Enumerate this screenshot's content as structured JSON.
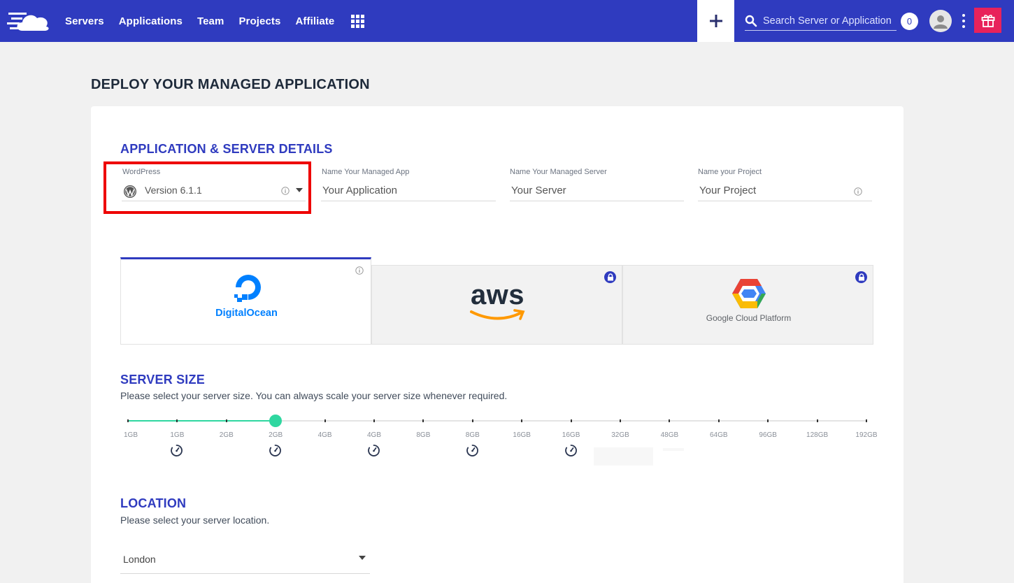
{
  "nav": {
    "items": [
      "Servers",
      "Applications",
      "Team",
      "Projects",
      "Affiliate"
    ]
  },
  "search": {
    "placeholder": "Search Server or Application"
  },
  "notifications": {
    "count": "0"
  },
  "page": {
    "title": "DEPLOY YOUR MANAGED APPLICATION"
  },
  "app_details": {
    "title": "APPLICATION & SERVER DETAILS",
    "fields": [
      {
        "label": "WordPress",
        "value": "Version 6.1.1"
      },
      {
        "label": "Name Your Managed App",
        "value": "Your Application"
      },
      {
        "label": "Name Your Managed Server",
        "value": "Your Server"
      },
      {
        "label": "Name your Project",
        "value": "Your Project"
      }
    ]
  },
  "providers": [
    {
      "name": "DigitalOcean",
      "locked": false,
      "selected": true
    },
    {
      "name": "aws",
      "locked": true,
      "selected": false
    },
    {
      "name": "Google Cloud Platform",
      "locked": true,
      "selected": false
    }
  ],
  "server_size": {
    "title": "SERVER SIZE",
    "subtitle": "Please select your server size. You can always scale your server size whenever required.",
    "ticks": [
      "1GB",
      "1GB",
      "2GB",
      "2GB",
      "4GB",
      "4GB",
      "8GB",
      "8GB",
      "16GB",
      "16GB",
      "32GB",
      "48GB",
      "64GB",
      "96GB",
      "128GB",
      "192GB"
    ],
    "selected_index": 3
  },
  "location": {
    "title": "LOCATION",
    "subtitle": "Please select your server location.",
    "value": "London"
  },
  "colors": {
    "primary": "#2f3bbf",
    "accent": "#2fd7a0",
    "gift": "#e8225b",
    "highlight": "#ee0000"
  }
}
